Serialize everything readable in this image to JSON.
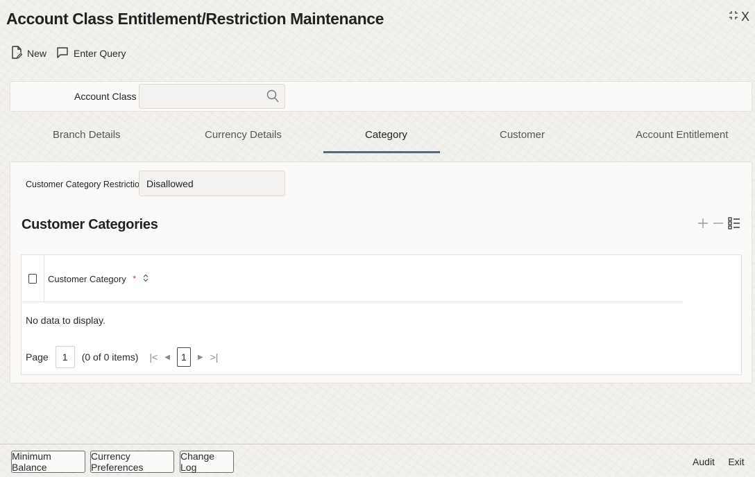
{
  "window": {
    "title": "Account Class Entitlement/Restriction Maintenance",
    "close_label": "X"
  },
  "toolbar": {
    "new_label": "New",
    "enter_query_label": "Enter Query"
  },
  "account_class": {
    "label": "Account Class",
    "required_mark": "*",
    "value": ""
  },
  "tabs": [
    {
      "label": "Branch Details"
    },
    {
      "label": "Currency Details"
    },
    {
      "label": "Category"
    },
    {
      "label": "Customer"
    },
    {
      "label": "Account Entitlement"
    }
  ],
  "active_tab": "Category",
  "restriction": {
    "label": "Customer Category Restriction",
    "value": "Disallowed"
  },
  "customer_categories": {
    "title": "Customer Categories",
    "column_header": "Customer Category",
    "required_mark": "*",
    "empty_message": "No data to display.",
    "pager": {
      "page_label": "Page",
      "page_value": "1",
      "items_text": "(0 of 0 items)",
      "current_page": "1"
    }
  },
  "footer": {
    "minimum_balance_label": "Minimum Balance",
    "currency_preferences_label": "Currency Preferences",
    "change_log_label": "Change Log",
    "audit_label": "Audit",
    "exit_label": "Exit"
  }
}
